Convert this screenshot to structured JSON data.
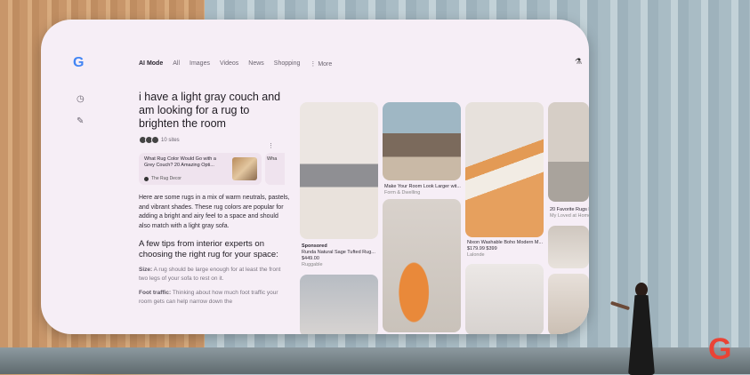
{
  "app": {
    "logo": "G"
  },
  "nav": {
    "tabs": [
      "AI Mode",
      "All",
      "Images",
      "Videos",
      "News",
      "Shopping"
    ],
    "more": "⋮ More"
  },
  "icons": {
    "history": "history-icon",
    "new_chat": "edit-icon",
    "labs": "flask-icon"
  },
  "query": "i have a light gray couch and am looking for a rug to brighten the room",
  "sources": {
    "count_label": "10 sites"
  },
  "source_card": {
    "title": "What Rug Color Would Go with a Grey Couch? 20 Amazing Opti...",
    "site": "The Rug Decor",
    "next_peek": "Wha"
  },
  "answer": {
    "intro": "Here are some rugs in a mix of warm neutrals, pastels, and vibrant shades. These rug colors are popular for adding a bright and airy feel to a space and should also match with a light gray sofa.",
    "tips_heading": "A few tips from interior experts on choosing the right rug for your space:",
    "tip1_label": "Size:",
    "tip1_text": "A rug should be large enough for at least the front two legs of your sofa to rest on it.",
    "tip2_label": "Foot traffic:",
    "tip2_text": "Thinking about how much foot traffic your room gets can help narrow down the"
  },
  "results": [
    {
      "sponsored": "Sponsored",
      "title": "Runda Natural Sage Tufted Rug...",
      "price": "$449.00",
      "store": "Ruggable"
    },
    {
      "title": "Make Your Room Look Larger wit...",
      "store": "Form & Dwelling"
    },
    {
      "title": "Nixon Washable Boho Modern M...",
      "price": "$179.99 $399",
      "store": "Lalonde"
    },
    {
      "title": "20 Favorite Rugs F...",
      "store": "My Loved at Home"
    }
  ],
  "presenter_logo": "G"
}
